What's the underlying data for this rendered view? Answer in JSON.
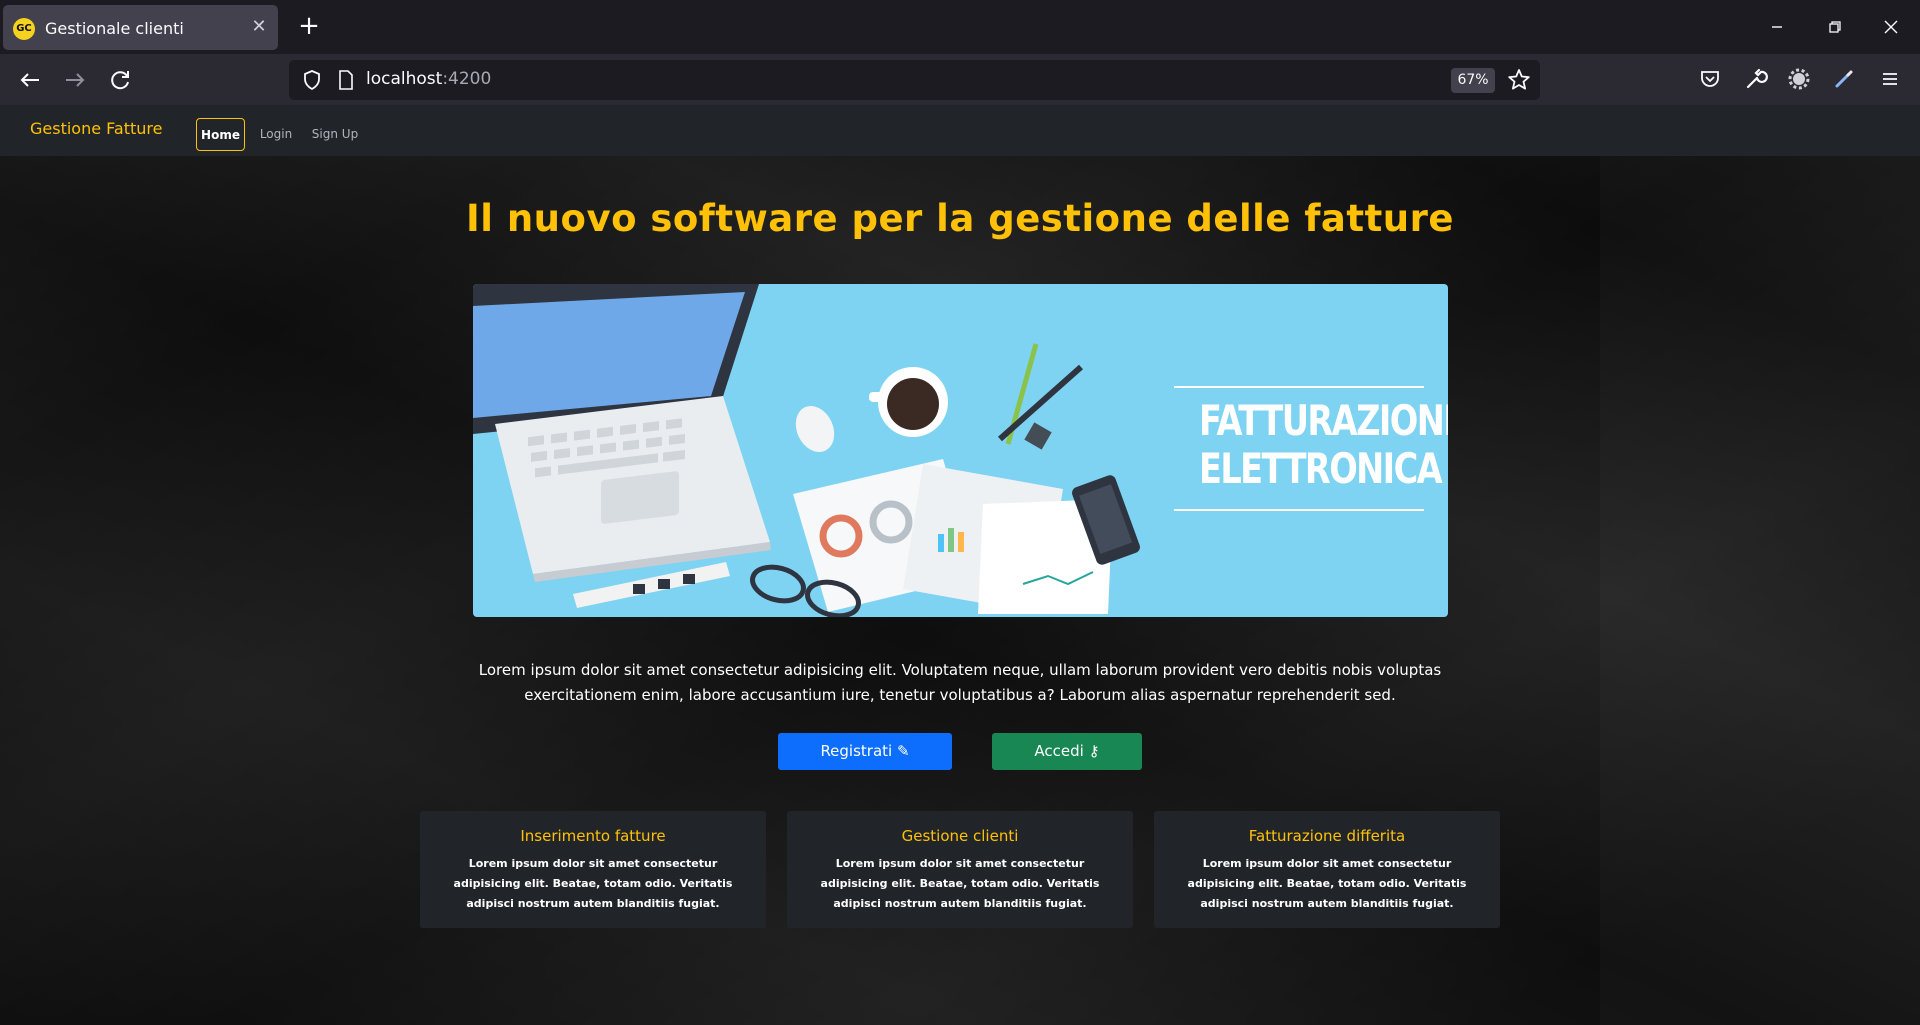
{
  "browser": {
    "tab_title": "Gestionale clienti",
    "tab_favicon_text": "GC",
    "close_glyph": "✕",
    "newtab_glyph": "+",
    "url_host": "localhost",
    "url_port": ":4200",
    "zoom": "67%"
  },
  "site": {
    "brand": "Gestione Fatture",
    "nav": [
      "Home",
      "Login",
      "Sign Up"
    ],
    "active_nav": "Home",
    "hero_title": "Il nuovo software per la gestione delle fatture",
    "banner_text": [
      "FATTURAZIONE",
      "ELETTRONICA"
    ],
    "lead": "Lorem ipsum dolor sit amet consectetur adipisicing elit. Voluptatem neque, ullam laborum provident vero debitis nobis voluptas exercitationem enim, labore accusantium iure, tenetur voluptatibus a? Laborum alias aspernatur reprehenderit sed.",
    "buttons": {
      "register": "Registrati ✎",
      "login": "Accedi ⚷"
    },
    "cards": [
      {
        "title": "Inserimento fatture",
        "text": "Lorem ipsum dolor sit amet consectetur adipisicing elit. Beatae, totam odio. Veritatis adipisci nostrum autem blanditiis fugiat."
      },
      {
        "title": "Gestione clienti",
        "text": "Lorem ipsum dolor sit amet consectetur adipisicing elit. Beatae, totam odio. Veritatis adipisci nostrum autem blanditiis fugiat."
      },
      {
        "title": "Fatturazione differita",
        "text": "Lorem ipsum dolor sit amet consectetur adipisicing elit. Beatae, totam odio. Veritatis adipisci nostrum autem blanditiis fugiat."
      }
    ]
  },
  "colors": {
    "accent": "#ffc107",
    "primary_button": "#0d6efd",
    "success_button": "#198754",
    "navbar": "#212529",
    "banner_bg": "#7dd3f1"
  }
}
